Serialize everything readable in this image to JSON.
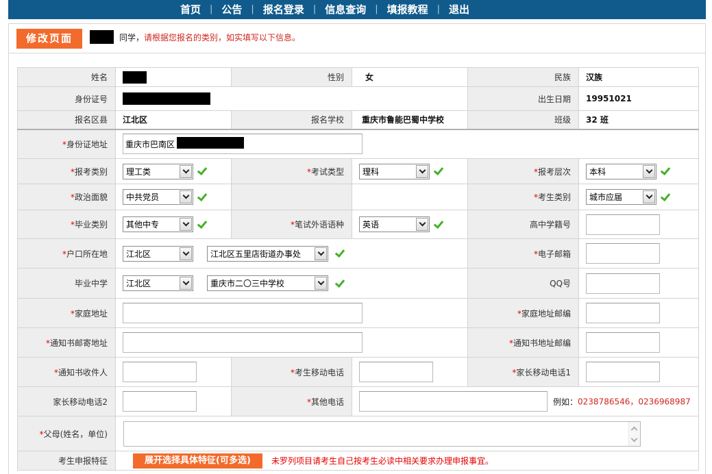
{
  "nav": {
    "separator": "|",
    "items": [
      {
        "label": "首页"
      },
      {
        "label": "公告"
      },
      {
        "label": "报名登录"
      },
      {
        "label": "信息查询"
      },
      {
        "label": "填报教程"
      },
      {
        "label": "退出"
      }
    ]
  },
  "header": {
    "page_tag": "修改页面",
    "greeting": "同学，",
    "instruction": "请根据您报名的类别，如实填写以下信息。"
  },
  "basic_info": {
    "name": {
      "label": "姓名"
    },
    "gender": {
      "label": "性别",
      "value": "女"
    },
    "ethnicity": {
      "label": "民族",
      "value": "汉族"
    },
    "id_number": {
      "label": "身份证号"
    },
    "birth_date": {
      "label": "出生日期",
      "value": "19951021"
    },
    "district": {
      "label": "报名区县",
      "value": "江北区"
    },
    "school": {
      "label": "报名学校",
      "value": "重庆市鲁能巴蜀中学校"
    },
    "class": {
      "label": "班级",
      "value": "32 班"
    }
  },
  "form": {
    "required_mark": "*",
    "id_address": {
      "label": "身份证地址",
      "value": "重庆市巴南区"
    },
    "exam_category": {
      "label": "报考类别",
      "value": "理工类"
    },
    "exam_type": {
      "label": "考试类型",
      "value": "理科"
    },
    "exam_level": {
      "label": "报考层次",
      "value": "本科"
    },
    "political_status": {
      "label": "政治面貌",
      "value": "中共党员"
    },
    "candidate_type": {
      "label": "考生类别",
      "value": "城市应届"
    },
    "graduation_type": {
      "label": "毕业类别",
      "value": "其他中专"
    },
    "foreign_language": {
      "label": "笔试外语语种",
      "value": "英语"
    },
    "student_number": {
      "label": "高中学籍号"
    },
    "hukou": {
      "label": "户口所在地",
      "district": "江北区",
      "street": "江北区五里店街道办事处"
    },
    "email": {
      "label": "电子邮箱"
    },
    "graduated_school": {
      "label": "毕业中学",
      "district": "江北区",
      "school": "重庆市二〇三中学校"
    },
    "qq": {
      "label": "QQ号"
    },
    "home_address": {
      "label": "家庭地址"
    },
    "home_postcode": {
      "label": "家庭地址邮编"
    },
    "notice_address": {
      "label": "通知书邮寄地址"
    },
    "notice_postcode": {
      "label": "通知书地址邮编"
    },
    "notice_recipient": {
      "label": "通知书收件人"
    },
    "student_mobile": {
      "label": "考生移动电话"
    },
    "parent_mobile_1": {
      "label": "家长移动电话1"
    },
    "parent_mobile_2": {
      "label": "家长移动电话2"
    },
    "other_phone": {
      "label": "其他电话",
      "example_label": "例如：",
      "example_value": "0238786546，0236968987"
    },
    "parents": {
      "label": "父母(姓名，单位)"
    },
    "features": {
      "label": "考生申报特征",
      "button_label": "展开选择具体特征(可多选)",
      "note": "未罗列项目请考生自己按考生必读中相关要求办理申报事宜。"
    }
  },
  "icons": {
    "field_valid": "check-icon",
    "dropdown": "chevron-down-icon"
  },
  "colors": {
    "nav_bg": "#115b8c",
    "accent_orange": "#f26b2c",
    "required_red": "#e60000",
    "instruction_red": "#d0261d",
    "check_green": "#43b02a",
    "label_bg": "#eeeeee"
  }
}
